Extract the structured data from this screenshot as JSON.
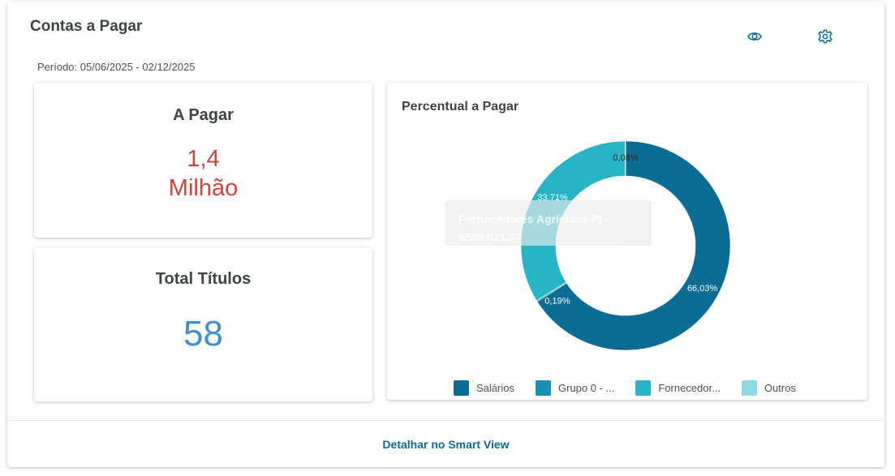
{
  "widget": {
    "title": "Contas a Pagar",
    "period": "Período: 05/06/2025 - 02/12/2025",
    "footer_link": "Detalhar no Smart View",
    "icons": {
      "view": "eye-icon",
      "settings": "gear-icon"
    }
  },
  "cards": {
    "a_pagar": {
      "title": "A Pagar",
      "value_line1": "1,4",
      "value_line2": "Milhão",
      "color": "#c9453f"
    },
    "total_titulos": {
      "title": "Total Títulos",
      "value": "58",
      "color": "#3d8fd1"
    }
  },
  "chart_data": {
    "type": "pie",
    "variant": "donut",
    "title": "Percentual a Pagar",
    "categories": [
      "Salários",
      "Grupo 0 - ...",
      "Fornecedor...",
      "Outros"
    ],
    "values": [
      66.03,
      0.19,
      33.71,
      0.08
    ],
    "slice_labels": [
      "66,03%",
      "0,19%",
      "33,71%",
      "0,08%"
    ],
    "colors": [
      "#0d6c93",
      "#1592b2",
      "#27b5c5",
      "#8fd9e0"
    ],
    "legend_position": "bottom",
    "tooltip": {
      "line1": "Fornecedores Agrícolas PI -",
      "line2": "$500.021,37"
    }
  }
}
